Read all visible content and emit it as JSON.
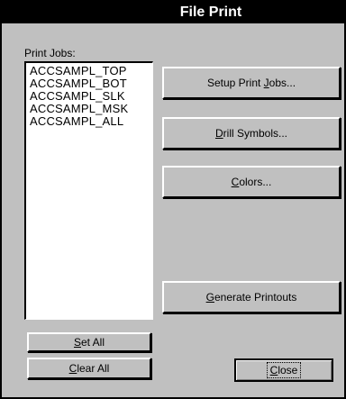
{
  "window": {
    "title": "File Print"
  },
  "print_jobs": {
    "label": "Print Jobs:",
    "items": [
      "ACCSAMPL_TOP",
      "ACCSAMPL_BOT",
      "ACCSAMPL_SLK",
      "ACCSAMPL_MSK",
      "ACCSAMPL_ALL"
    ]
  },
  "buttons": {
    "setup_print_jobs": {
      "pre": "Setup Print ",
      "key": "J",
      "post": "obs..."
    },
    "drill_symbols": {
      "pre": "",
      "key": "D",
      "post": "rill Symbols..."
    },
    "colors": {
      "pre": "",
      "key": "C",
      "post": "olors..."
    },
    "generate_printouts": {
      "pre": "",
      "key": "G",
      "post": "enerate Printouts"
    },
    "set_all": {
      "pre": "",
      "key": "S",
      "post": "et All"
    },
    "clear_all": {
      "pre": "",
      "key": "C",
      "post": "lear All"
    },
    "close": {
      "pre": "",
      "key": "C",
      "post": "lose"
    }
  }
}
